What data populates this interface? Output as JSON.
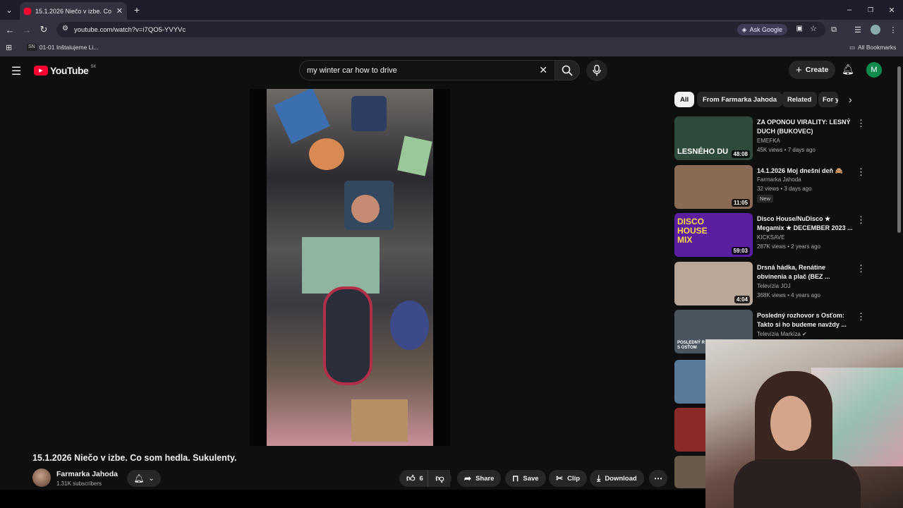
{
  "browser": {
    "tab_title": "15.1.2026 Niečo v izbe. Co som",
    "url": "youtube.com/watch?v=i7QO5-YVYVc",
    "ask_google": "Ask Google",
    "bookmark_1": "01-01 Inštalujeme Li...",
    "all_bookmarks": "All Bookmarks"
  },
  "youtube": {
    "logo_text": "YouTube",
    "region": "SK",
    "search_value": "my winter car how to drive",
    "create_label": "Create",
    "avatar_letter": "M"
  },
  "video": {
    "title": "15.1.2026 Niečo v izbe. Co som hedla. Sukulenty.",
    "channel": "Farmarka Jahoda",
    "subscribers": "1.31K subscribers",
    "likes": "6",
    "share": "Share",
    "save": "Save",
    "clip": "Clip",
    "download": "Download"
  },
  "chips": [
    "All",
    "From Farmarka Jahoda",
    "Related",
    "For y"
  ],
  "recommendations": [
    {
      "title": "ZA OPONOU VIRALITY: LESNÝ DUCH (BUKOVEC)",
      "channel": "EMEFKA",
      "meta": "45K views • 7 days ago",
      "duration": "48:08",
      "thumb_text": "LESNÉHO DU",
      "color": "#2d4a3a"
    },
    {
      "title": "14.1.2026 Moj dnešní deň 🙈",
      "channel": "Farmarka Jahoda",
      "meta": "32 views • 3 days ago",
      "badge": "New",
      "duration": "11:05",
      "color": "#8a6a55"
    },
    {
      "title": "Disco House/NuDisco ★ Megamix ★ DECEMBER 2023 ...",
      "channel": "KICKSAVE",
      "meta": "287K views • 2 years ago",
      "duration": "59:03",
      "thumb_text": "DISCO HOUSE MIX",
      "color": "#5a1fa0"
    },
    {
      "title": "Drsná hádka, Renátine obvinenia a plač (BEZ ...",
      "channel": "Televízia JOJ",
      "meta": "368K views • 4 years ago",
      "duration": "4:04",
      "color": "#b9a79a"
    },
    {
      "title": "Posledný rozhovor s Osťom: Takto si ho budeme navždy ...",
      "channel": "Televízia Markíza",
      "meta": "",
      "thumb_text": "POSLEDNÝ R S OSŤOM",
      "color": "#4a5560"
    }
  ]
}
